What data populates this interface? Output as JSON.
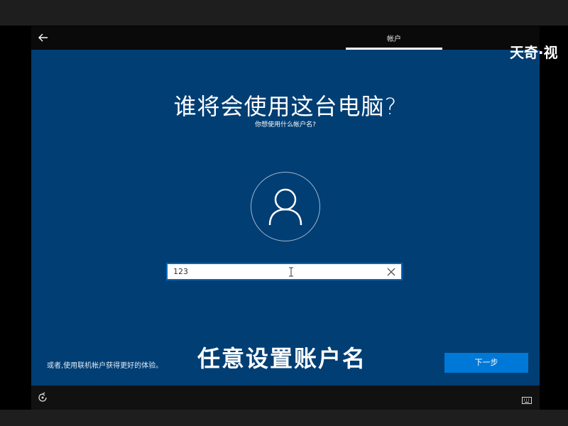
{
  "header": {
    "back_icon": "arrow-left-icon",
    "step_label": "帐户"
  },
  "main": {
    "title": "谁将会使用这台电脑?",
    "subtitle": "你想使用什么帐户名?",
    "avatar_icon": "person-icon",
    "username": {
      "value": "123",
      "clear_icon": "close-icon"
    }
  },
  "bottom": {
    "online_account_link": "或者,使用联机帐户获得更好的体验。",
    "caption": "任意设置账户名",
    "next_button": "下一步"
  },
  "footer": {
    "ease_of_access_icon": "ease-of-access-icon",
    "keyboard_icon": "keyboard-icon"
  },
  "watermark": "天奇·视",
  "colors": {
    "screen_bg": "#003e74",
    "accent": "#0078d7",
    "header_bg": "#0a0a0a"
  }
}
